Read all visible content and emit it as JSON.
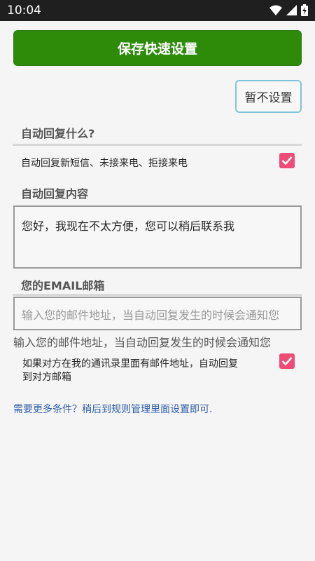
{
  "status": {
    "time": "10:04"
  },
  "toolbar": {
    "save_label": "保存快速设置",
    "skip_label": "暂不设置"
  },
  "sections": {
    "what_title": "自动回复什么?",
    "what_option": "自动回复新短信、未接来电、拒接来电",
    "what_option_checked": true,
    "content_title": "自动回复内容",
    "content_value": "您好，我现在不太方便，您可以稍后联系我",
    "email_title": "您的EMAIL邮箱",
    "email_placeholder": "输入您的邮件地址，当自动回复发生的时候会通知您",
    "email_echo": "输入您的邮件地址，当自动回复发生的时候会通知您",
    "email_option": "如果对方在我的通讯录里面有邮件地址，自动回复到对方邮箱",
    "email_option_line1": "如果对方在我的通讯录里面有邮件地址，自动回复",
    "email_option_line2": "到对方邮箱",
    "email_option_checked": true,
    "more_link": "需要更多条件？稍后到规则管理里面设置即可."
  },
  "colors": {
    "accent_green": "#2e8b0a",
    "checkbox_pink": "#ee4c77",
    "link_blue": "#2f5fa8"
  }
}
